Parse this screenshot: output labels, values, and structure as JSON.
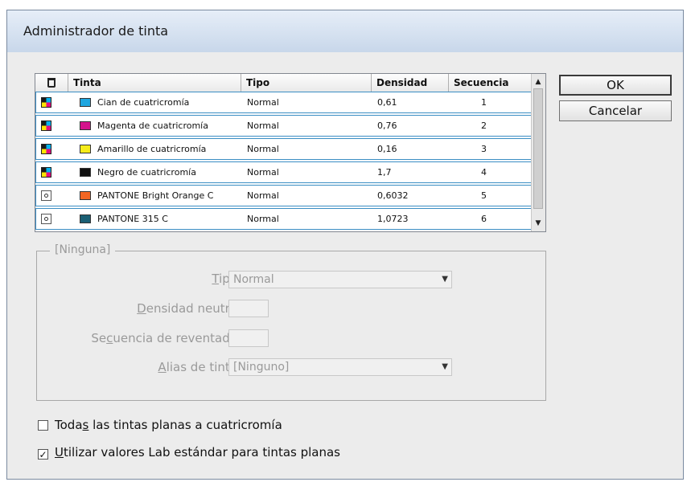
{
  "window": {
    "title": "Administrador de tinta"
  },
  "table": {
    "headers": {
      "icon": "icon-column",
      "tinta": "Tinta",
      "tipo": "Tipo",
      "densidad": "Densidad",
      "secuencia": "Secuencia"
    },
    "rows": [
      {
        "kind": "process",
        "name": "Cian de cuatricromía",
        "swatch": "#1ea6e0",
        "tipo": "Normal",
        "densidad": "0,61",
        "secuencia": "1"
      },
      {
        "kind": "process",
        "name": "Magenta de cuatricromía",
        "swatch": "#d4148c",
        "tipo": "Normal",
        "densidad": "0,76",
        "secuencia": "2"
      },
      {
        "kind": "process",
        "name": "Amarillo de cuatricromía",
        "swatch": "#f6ec1a",
        "tipo": "Normal",
        "densidad": "0,16",
        "secuencia": "3"
      },
      {
        "kind": "process",
        "name": "Negro de cuatricromía",
        "swatch": "#111111",
        "tipo": "Normal",
        "densidad": "1,7",
        "secuencia": "4"
      },
      {
        "kind": "spot",
        "name": "PANTONE Bright Orange C",
        "swatch": "#f26522",
        "tipo": "Normal",
        "densidad": "0,6032",
        "secuencia": "5"
      },
      {
        "kind": "spot",
        "name": "PANTONE 315 C",
        "swatch": "#1a5f74",
        "tipo": "Normal",
        "densidad": "1,0723",
        "secuencia": "6"
      }
    ]
  },
  "buttons": {
    "ok": "OK",
    "cancel": "Cancelar"
  },
  "details": {
    "group_title": "[Ninguna]",
    "tipo_label": "Tipo:",
    "tipo_value": "Normal",
    "densidad_label": "Densidad neutra:",
    "densidad_value": "",
    "secuencia_label": "Secuencia de reventado:",
    "secuencia_value": "",
    "alias_label": "Alias de tinta:",
    "alias_value": "[Ninguno]"
  },
  "options": {
    "all_spots_to_process": {
      "label": "Todas las tintas planas a cuatricromía",
      "checked": false
    },
    "use_lab_values": {
      "label": "Utilizar valores Lab estándar para tintas planas",
      "checked": true
    }
  }
}
